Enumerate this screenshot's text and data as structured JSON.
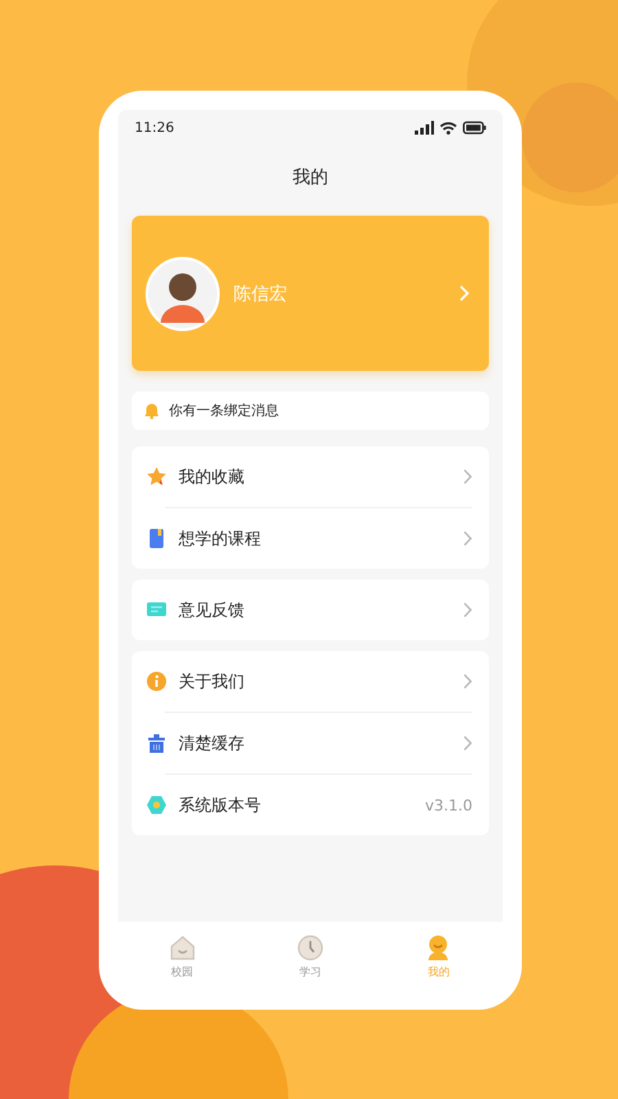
{
  "status_bar": {
    "time": "11:26"
  },
  "page_title": "我的",
  "profile": {
    "name": "陈信宏"
  },
  "notice": {
    "text": "你有一条绑定消息"
  },
  "menu_groups": [
    {
      "items": [
        {
          "label": "我的收藏",
          "kind": "link"
        },
        {
          "label": "想学的课程",
          "kind": "link"
        }
      ]
    },
    {
      "items": [
        {
          "label": "意见反馈",
          "kind": "link"
        }
      ]
    },
    {
      "items": [
        {
          "label": "关于我们",
          "kind": "link"
        },
        {
          "label": "清楚缓存",
          "kind": "link"
        },
        {
          "label": "系统版本号",
          "kind": "value",
          "value": "v3.1.0"
        }
      ]
    }
  ],
  "tab_bar": [
    {
      "label": "校园",
      "selected": false
    },
    {
      "label": "学习",
      "selected": false
    },
    {
      "label": "我的",
      "selected": true
    }
  ]
}
